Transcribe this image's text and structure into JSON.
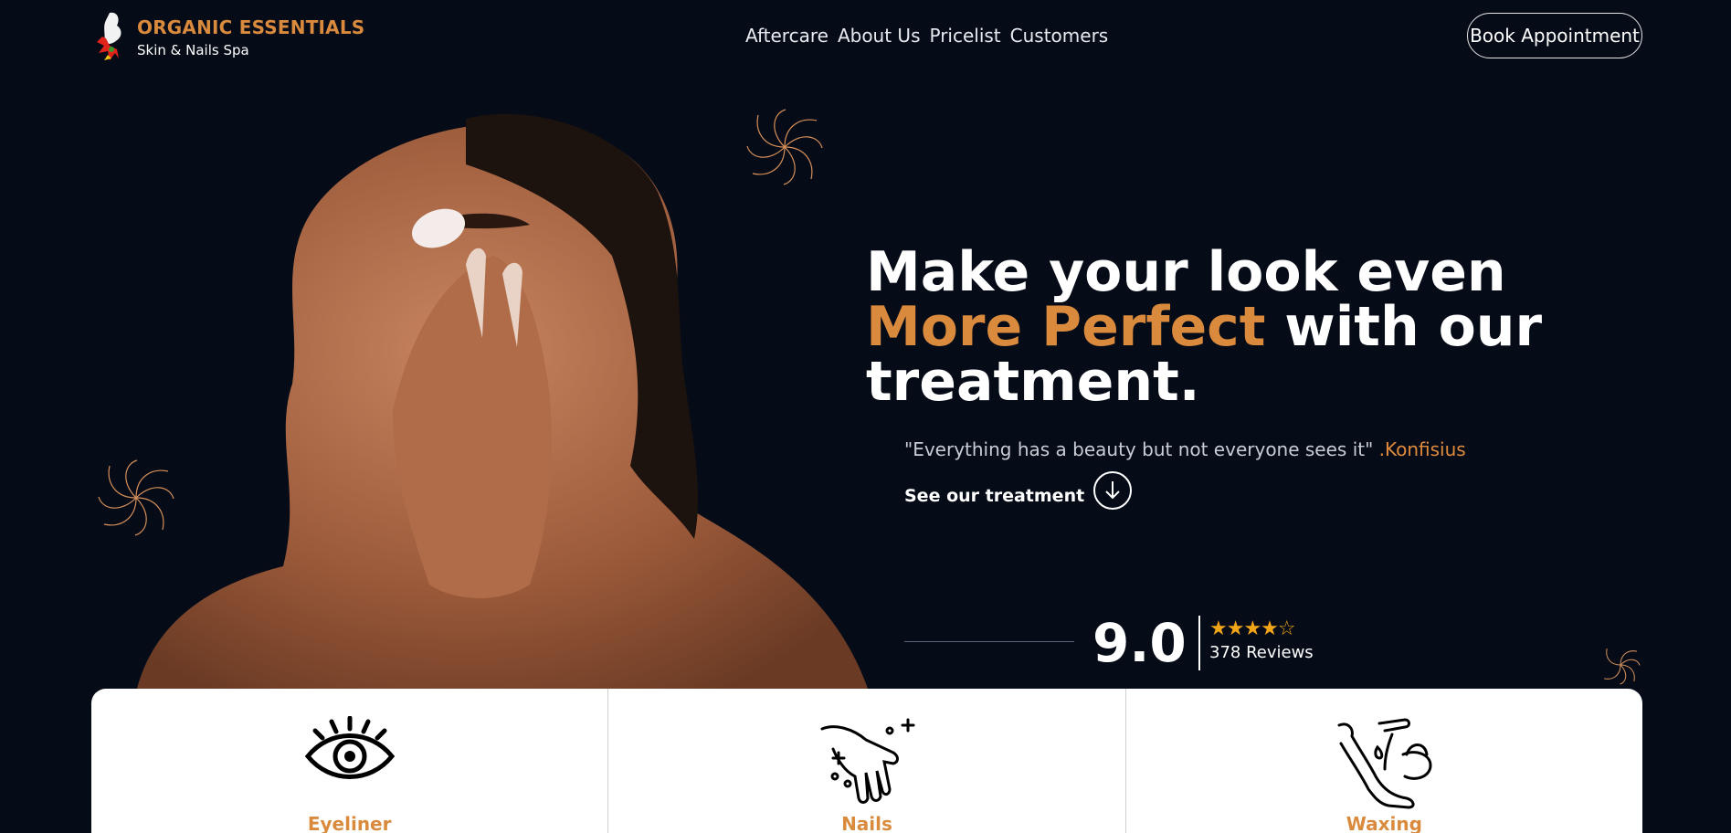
{
  "header": {
    "brand_title": "ORGANIC ESSENTIALS",
    "brand_subtitle": "Skin & Nails Spa",
    "logo_icon": "spa-logo-icon",
    "nav": [
      "Aftercare",
      "About Us",
      "Pricelist",
      "Customers"
    ],
    "book_label": "Book Appointment"
  },
  "hero": {
    "headline_part1": "Make your look even ",
    "headline_accent": "More Perfect",
    "headline_part2": " with our treatment.",
    "quote_text": "\"Everything has a beauty but not everyone sees it\"",
    "quote_author": " .Konfisius",
    "cta_label": "See our treatment",
    "cta_icon": "arrow-down-circle-icon"
  },
  "rating": {
    "score": "9.0",
    "stars": "★★★★☆",
    "stars_value": 4.5,
    "reviews": "378 Reviews"
  },
  "services": [
    {
      "label": "Eyeliner",
      "icon": "eye-icon"
    },
    {
      "label": "Nails",
      "icon": "hand-nails-icon"
    },
    {
      "label": "Waxing",
      "icon": "leg-waxing-icon"
    }
  ],
  "colors": {
    "background": "#050b17",
    "accent": "#d98a3d",
    "star": "#f2a516"
  }
}
